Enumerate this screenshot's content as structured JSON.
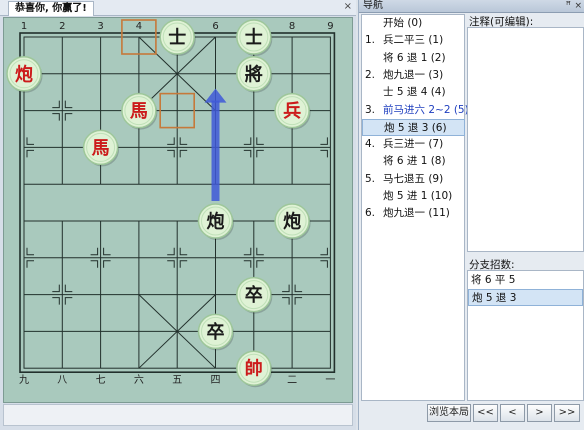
{
  "tab": {
    "title": "恭喜你, 你赢了!",
    "close_glyph": "×"
  },
  "board": {
    "top_labels": [
      "1",
      "2",
      "3",
      "4",
      "5",
      "6",
      "7",
      "8",
      "9"
    ],
    "bottom_labels": [
      "九",
      "八",
      "七",
      "六",
      "五",
      "四",
      "三",
      "二",
      "一"
    ],
    "red_color": "#cc1b1b",
    "black_color": "#1a1a1a",
    "pieces": [
      {
        "char": "士",
        "side": "black",
        "file": 4,
        "rank": 0
      },
      {
        "char": "士",
        "side": "black",
        "file": 6,
        "rank": 0
      },
      {
        "char": "將",
        "side": "black",
        "file": 6,
        "rank": 1
      },
      {
        "char": "炮",
        "side": "red",
        "file": 0,
        "rank": 1
      },
      {
        "char": "馬",
        "side": "red",
        "file": 3,
        "rank": 2
      },
      {
        "char": "兵",
        "side": "red",
        "file": 7,
        "rank": 2
      },
      {
        "char": "馬",
        "side": "red",
        "file": 2,
        "rank": 3
      },
      {
        "char": "炮",
        "side": "black",
        "file": 5,
        "rank": 5
      },
      {
        "char": "炮",
        "side": "black",
        "file": 7,
        "rank": 5
      },
      {
        "char": "卒",
        "side": "black",
        "file": 6,
        "rank": 7
      },
      {
        "char": "卒",
        "side": "black",
        "file": 5,
        "rank": 8
      },
      {
        "char": "帥",
        "side": "red",
        "file": 6,
        "rank": 9
      }
    ],
    "last_move_from": {
      "file": 3,
      "rank": 0
    },
    "last_move_to": {
      "file": 4,
      "rank": 2
    },
    "arrow": {
      "from": {
        "file": 5,
        "rank": 5
      },
      "to": {
        "file": 5,
        "rank": 2
      },
      "color": "#3f59d8"
    }
  },
  "nav": {
    "title": "导航",
    "pin_glyph": "ꟸ",
    "close_glyph": "×",
    "moves": [
      {
        "num": "",
        "text": "开始 (0)",
        "style": "normal"
      },
      {
        "num": "1.",
        "text": "兵二平三 (1)",
        "style": "normal"
      },
      {
        "num": "",
        "text": "将 6 退 1 (2)",
        "style": "normal"
      },
      {
        "num": "2.",
        "text": "炮九退一 (3)",
        "style": "normal"
      },
      {
        "num": "",
        "text": "士 5 退 4 (4)",
        "style": "normal"
      },
      {
        "num": "3.",
        "text": "前马进六 2~2 (5)",
        "style": "branch"
      },
      {
        "num": "",
        "text": "炮 5 退 3 (6)",
        "style": "selected"
      },
      {
        "num": "4.",
        "text": "兵三进一 (7)",
        "style": "normal"
      },
      {
        "num": "",
        "text": "将 6 进 1 (8)",
        "style": "normal"
      },
      {
        "num": "5.",
        "text": "马七退五 (9)",
        "style": "normal"
      },
      {
        "num": "",
        "text": "炮 5 进 1 (10)",
        "style": "normal"
      },
      {
        "num": "6.",
        "text": "炮九退一 (11)",
        "style": "normal"
      }
    ],
    "notes_label": "注释(可编辑):",
    "branch_label": "分支招数:",
    "branches": [
      {
        "text": "将 6 平 5",
        "selected": false
      },
      {
        "text": "炮 5 退 3",
        "selected": true
      }
    ],
    "buttons": [
      {
        "label": "浏览本局",
        "name": "browse-game-button"
      },
      {
        "label": "<<",
        "name": "first-move-button"
      },
      {
        "label": "<",
        "name": "prev-move-button"
      },
      {
        "label": ">",
        "name": "next-move-button"
      },
      {
        "label": ">>",
        "name": "last-move-button"
      }
    ]
  }
}
